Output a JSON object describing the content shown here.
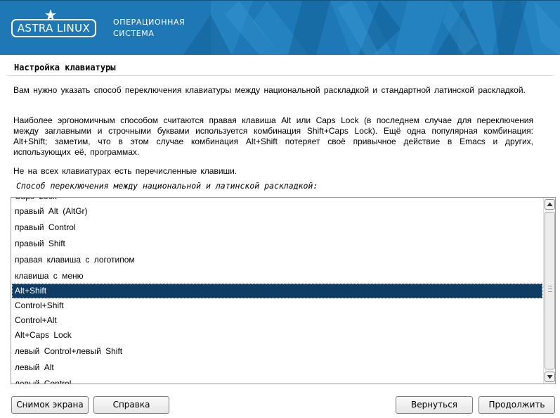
{
  "banner": {
    "logo_text": "ASTRA LINUX",
    "logo_symbol": "star-icon",
    "os_title_line1": "ОПЕРАЦИОННАЯ",
    "os_title_line2": "СИСТЕМА",
    "colors": {
      "background": "#1d78b5",
      "pattern_light": "#2a8bc9",
      "pattern_dark": "#135f96"
    }
  },
  "page": {
    "title": "Настройка клавиатуры",
    "paragraph1": "Вам нужно указать способ переключения клавиатуры между национальной раскладкой и стандартной латинской раскладкой.",
    "paragraph2": "Наиболее эргономичным способом считаются правая клавиша Alt или Caps Lock (в последнем случае для переключения между заглавными и строчными буквами используется комбинация Shift+Caps Lock). Ещё одна популярная комбинация: Alt+Shift; заметим, что в этом случае комбинация Alt+Shift потеряет своё привычное действие в Emacs и других, использующих её, программах.",
    "paragraph3": "Не на всех клавиатурах есть перечисленные клавиши.",
    "prompt": "Способ переключения между национальной и латинской раскладкой:"
  },
  "list": {
    "items": [
      "Caps Lock",
      "правый Alt (AltGr)",
      "правый Control",
      "правый Shift",
      "правая клавиша с логотипом",
      "клавиша с меню",
      "Alt+Shift",
      "Control+Shift",
      "Control+Alt",
      "Alt+Caps Lock",
      "левый Control+левый Shift",
      "левый Alt",
      "левый Control"
    ],
    "selected": "Alt+Shift",
    "colors": {
      "selected_background": "#0f3c63",
      "selected_text": "#ffffff"
    }
  },
  "buttons": {
    "screenshot": "Снимок экрана",
    "help": "Справка",
    "back": "Вернуться",
    "continue": "Продолжить"
  }
}
